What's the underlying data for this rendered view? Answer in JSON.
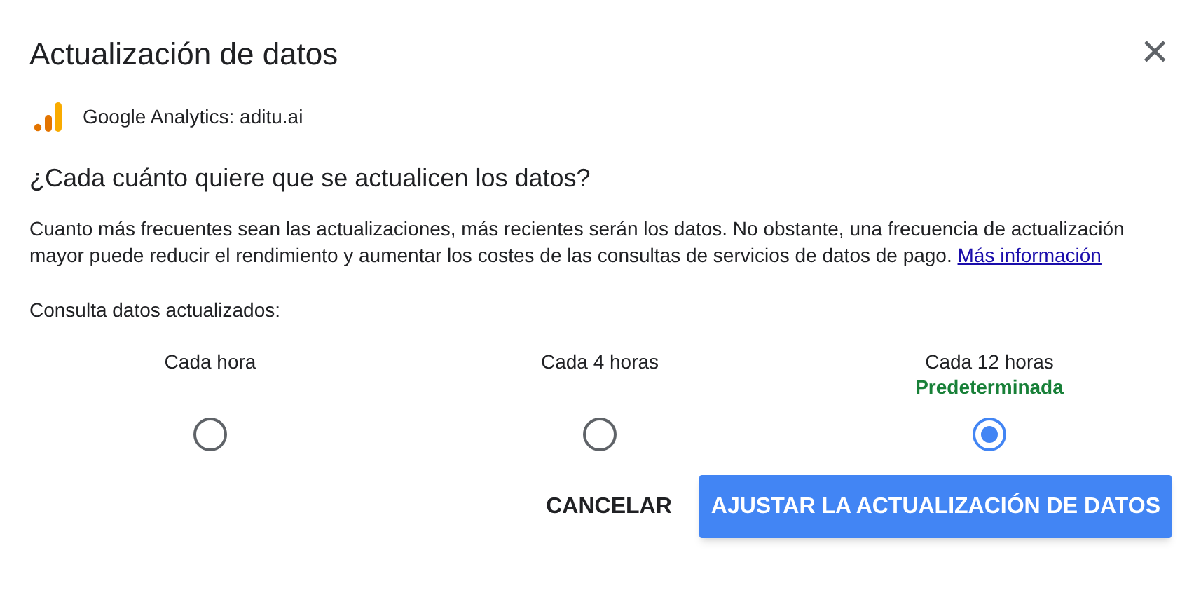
{
  "dialog": {
    "title": "Actualización de datos",
    "close_icon": "×",
    "source": "Google Analytics: aditu.ai",
    "question": "¿Cada cuánto quiere que se actualicen los datos?",
    "description": "Cuanto más frecuentes sean las actualizaciones, más recientes serán los datos. No obstante, una frecuencia de actualización mayor puede reducir el rendimiento y aumentar los costes de las consultas de servicios de datos de pago.",
    "link": "Más información",
    "options_label": "Consulta datos actualizados:",
    "options": [
      {
        "label": "Cada hora",
        "selected": false
      },
      {
        "label": "Cada 4 horas",
        "selected": false
      },
      {
        "label": "Cada 12 horas",
        "badge": "Predeterminada",
        "selected": true
      }
    ],
    "buttons": [
      {
        "label": "CANCELAR",
        "kind": "text"
      },
      {
        "label": "AJUSTAR LA ACTUALIZACIÓN DE DATOS",
        "kind": "primary"
      }
    ]
  }
}
